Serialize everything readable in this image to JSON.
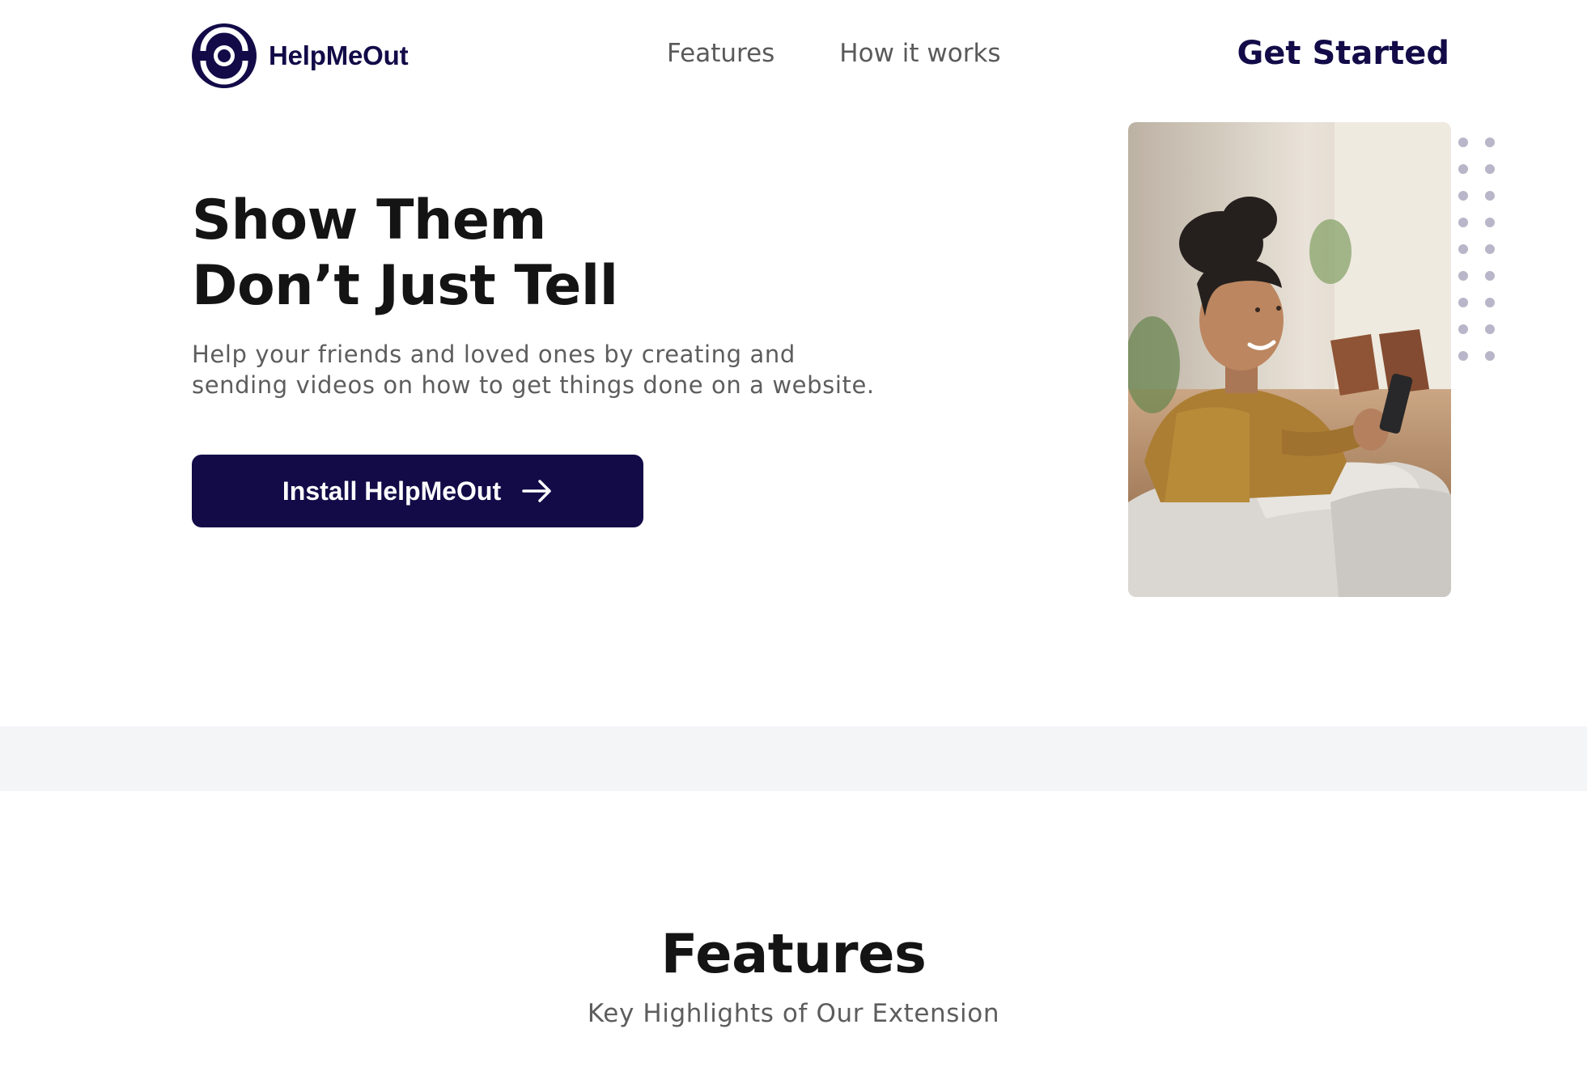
{
  "header": {
    "brand_name": "HelpMeOut",
    "logo_icon": "helpmeout-logo-icon",
    "nav": [
      {
        "label": "Features"
      },
      {
        "label": "How it works"
      }
    ],
    "cta_label": "Get Started"
  },
  "hero": {
    "title_line_1": "Show Them",
    "title_line_2": "Don’t Just Tell",
    "subtitle_line_1": "Help your friends and loved ones by creating and",
    "subtitle_line_2": "sending videos on how to get things done on a website.",
    "install_label": "Install HelpMeOut",
    "install_icon": "arrow-right-icon",
    "image_alt": "Smiling woman in a mustard sweater looking at her phone on a sofa"
  },
  "features": {
    "title": "Features",
    "subtitle": "Key Highlights of Our Extension"
  },
  "colors": {
    "brand": "#120B48",
    "text_dark": "#141414",
    "text_muted": "#5d5d5d",
    "band": "#f4f5f7",
    "dots": "#b8b6c8"
  }
}
